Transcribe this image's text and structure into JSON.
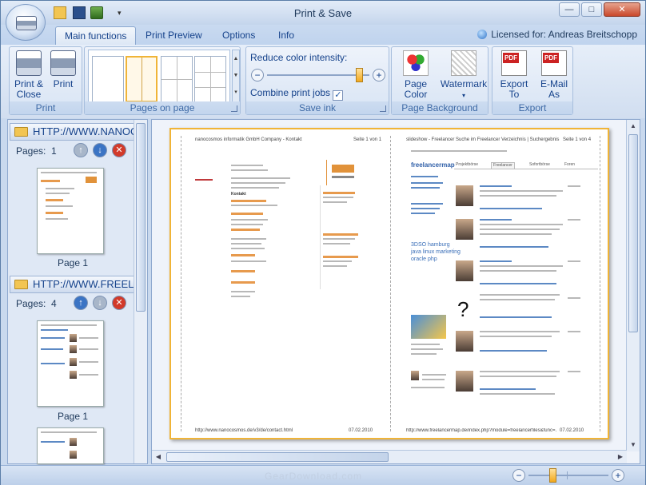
{
  "window": {
    "title": "Print & Save",
    "controls": {
      "minimize": "—",
      "maximize": "□",
      "close": "✕"
    }
  },
  "tabs": [
    {
      "label": "Main functions",
      "active": true
    },
    {
      "label": "Print Preview",
      "active": false
    },
    {
      "label": "Options",
      "active": false
    },
    {
      "label": "Info",
      "active": false
    }
  ],
  "license": "Licensed for: Andreas Breitschopp",
  "ribbon": {
    "print_group": {
      "label": "Print",
      "print_close": "Print &\nClose",
      "print": "Print"
    },
    "pages_group": {
      "label": "Pages on page"
    },
    "save_ink_group": {
      "label": "Save ink",
      "reduce_label": "Reduce color intensity:",
      "reduce_value": 0.9,
      "combine_label": "Combine print jobs",
      "combine_checked": true
    },
    "page_background_group": {
      "label": "Page Background",
      "page_color": "Page Color",
      "watermark": "Watermark"
    },
    "export_group": {
      "label": "Export",
      "export_to": "Export To",
      "email_as": "E-Mail As"
    }
  },
  "documents": [
    {
      "url": "HTTP://WWW.NANOCOSI",
      "pages_label": "Pages:",
      "pages": "1",
      "thumb_label": "Page 1"
    },
    {
      "url": "HTTP://WWW.FREELANC",
      "pages_label": "Pages:",
      "pages": "4",
      "thumb_label": "Page 1"
    }
  ],
  "preview": {
    "left_page": {
      "header_left": "nanocosmos informatik GmbH Company - Kontakt",
      "header_right": "Seite 1 von 1",
      "heading": "Kontakt",
      "footer_url": "http://www.nanocosmos.de/v3/de/contact.html",
      "footer_date": "07.02.2010"
    },
    "right_page": {
      "header_left": "slideshow - Freelancer Suche im Freelancer Verzeichnis | Suchergebnis",
      "header_right": "Seite 1 von 4",
      "brand": "freelancermap",
      "tabs": [
        "Projektbörse",
        "Freelancer",
        "Sofortbörse",
        "Foren"
      ],
      "tags": [
        "3DSO",
        "hamburg",
        "java",
        "linux",
        "marketing",
        "oracle",
        "php"
      ],
      "footer_url": "http://www.freelancermap.de/index.php?module=freelancerfiles&func=...",
      "footer_date": "07.02.2010"
    }
  },
  "status": {
    "watermark": "GearDownload.com",
    "zoom_level": 0.3
  }
}
